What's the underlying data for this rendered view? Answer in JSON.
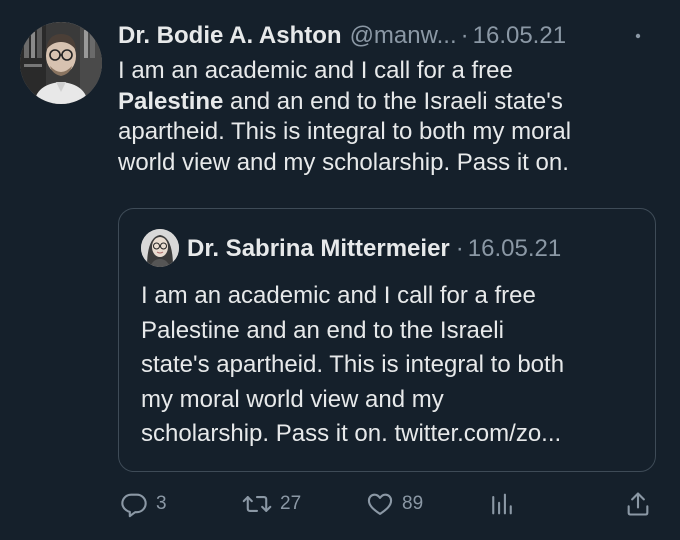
{
  "tweet": {
    "display_name": "Dr. Bodie A. Ashton",
    "handle": "@manw...",
    "separator": "·",
    "date": "16.05.21",
    "text_line1": "I am an academic and I call for a free",
    "text_bold": "Palestine",
    "text_after_bold": " and an end to the Israeli state's",
    "text_line3": "apartheid. This is integral to both my moral",
    "text_line4": "world view and my scholarship. Pass it on."
  },
  "quoted_tweet": {
    "display_name": "Dr. Sabrina Mittermeier",
    "separator": "·",
    "date": "16.05.21",
    "text_line1": "I am an academic and I call for a free",
    "text_line2": "Palestine and an end to the Israeli",
    "text_line3": "state's apartheid. This is integral to both",
    "text_line4": "my moral world view and my",
    "text_line5": "scholarship. Pass it on. twitter.com/zo..."
  },
  "actions": {
    "reply_count": "3",
    "retweet_count": "27",
    "like_count": "89"
  },
  "icons": {
    "more": "more-icon",
    "reply": "reply-icon",
    "retweet": "retweet-icon",
    "like": "heart-icon",
    "views": "bar-chart-icon",
    "share": "share-icon"
  },
  "colors": {
    "background": "#15202b",
    "text_primary": "#e7e9ea",
    "text_secondary": "#8b98a5",
    "border": "#3e4b57"
  }
}
